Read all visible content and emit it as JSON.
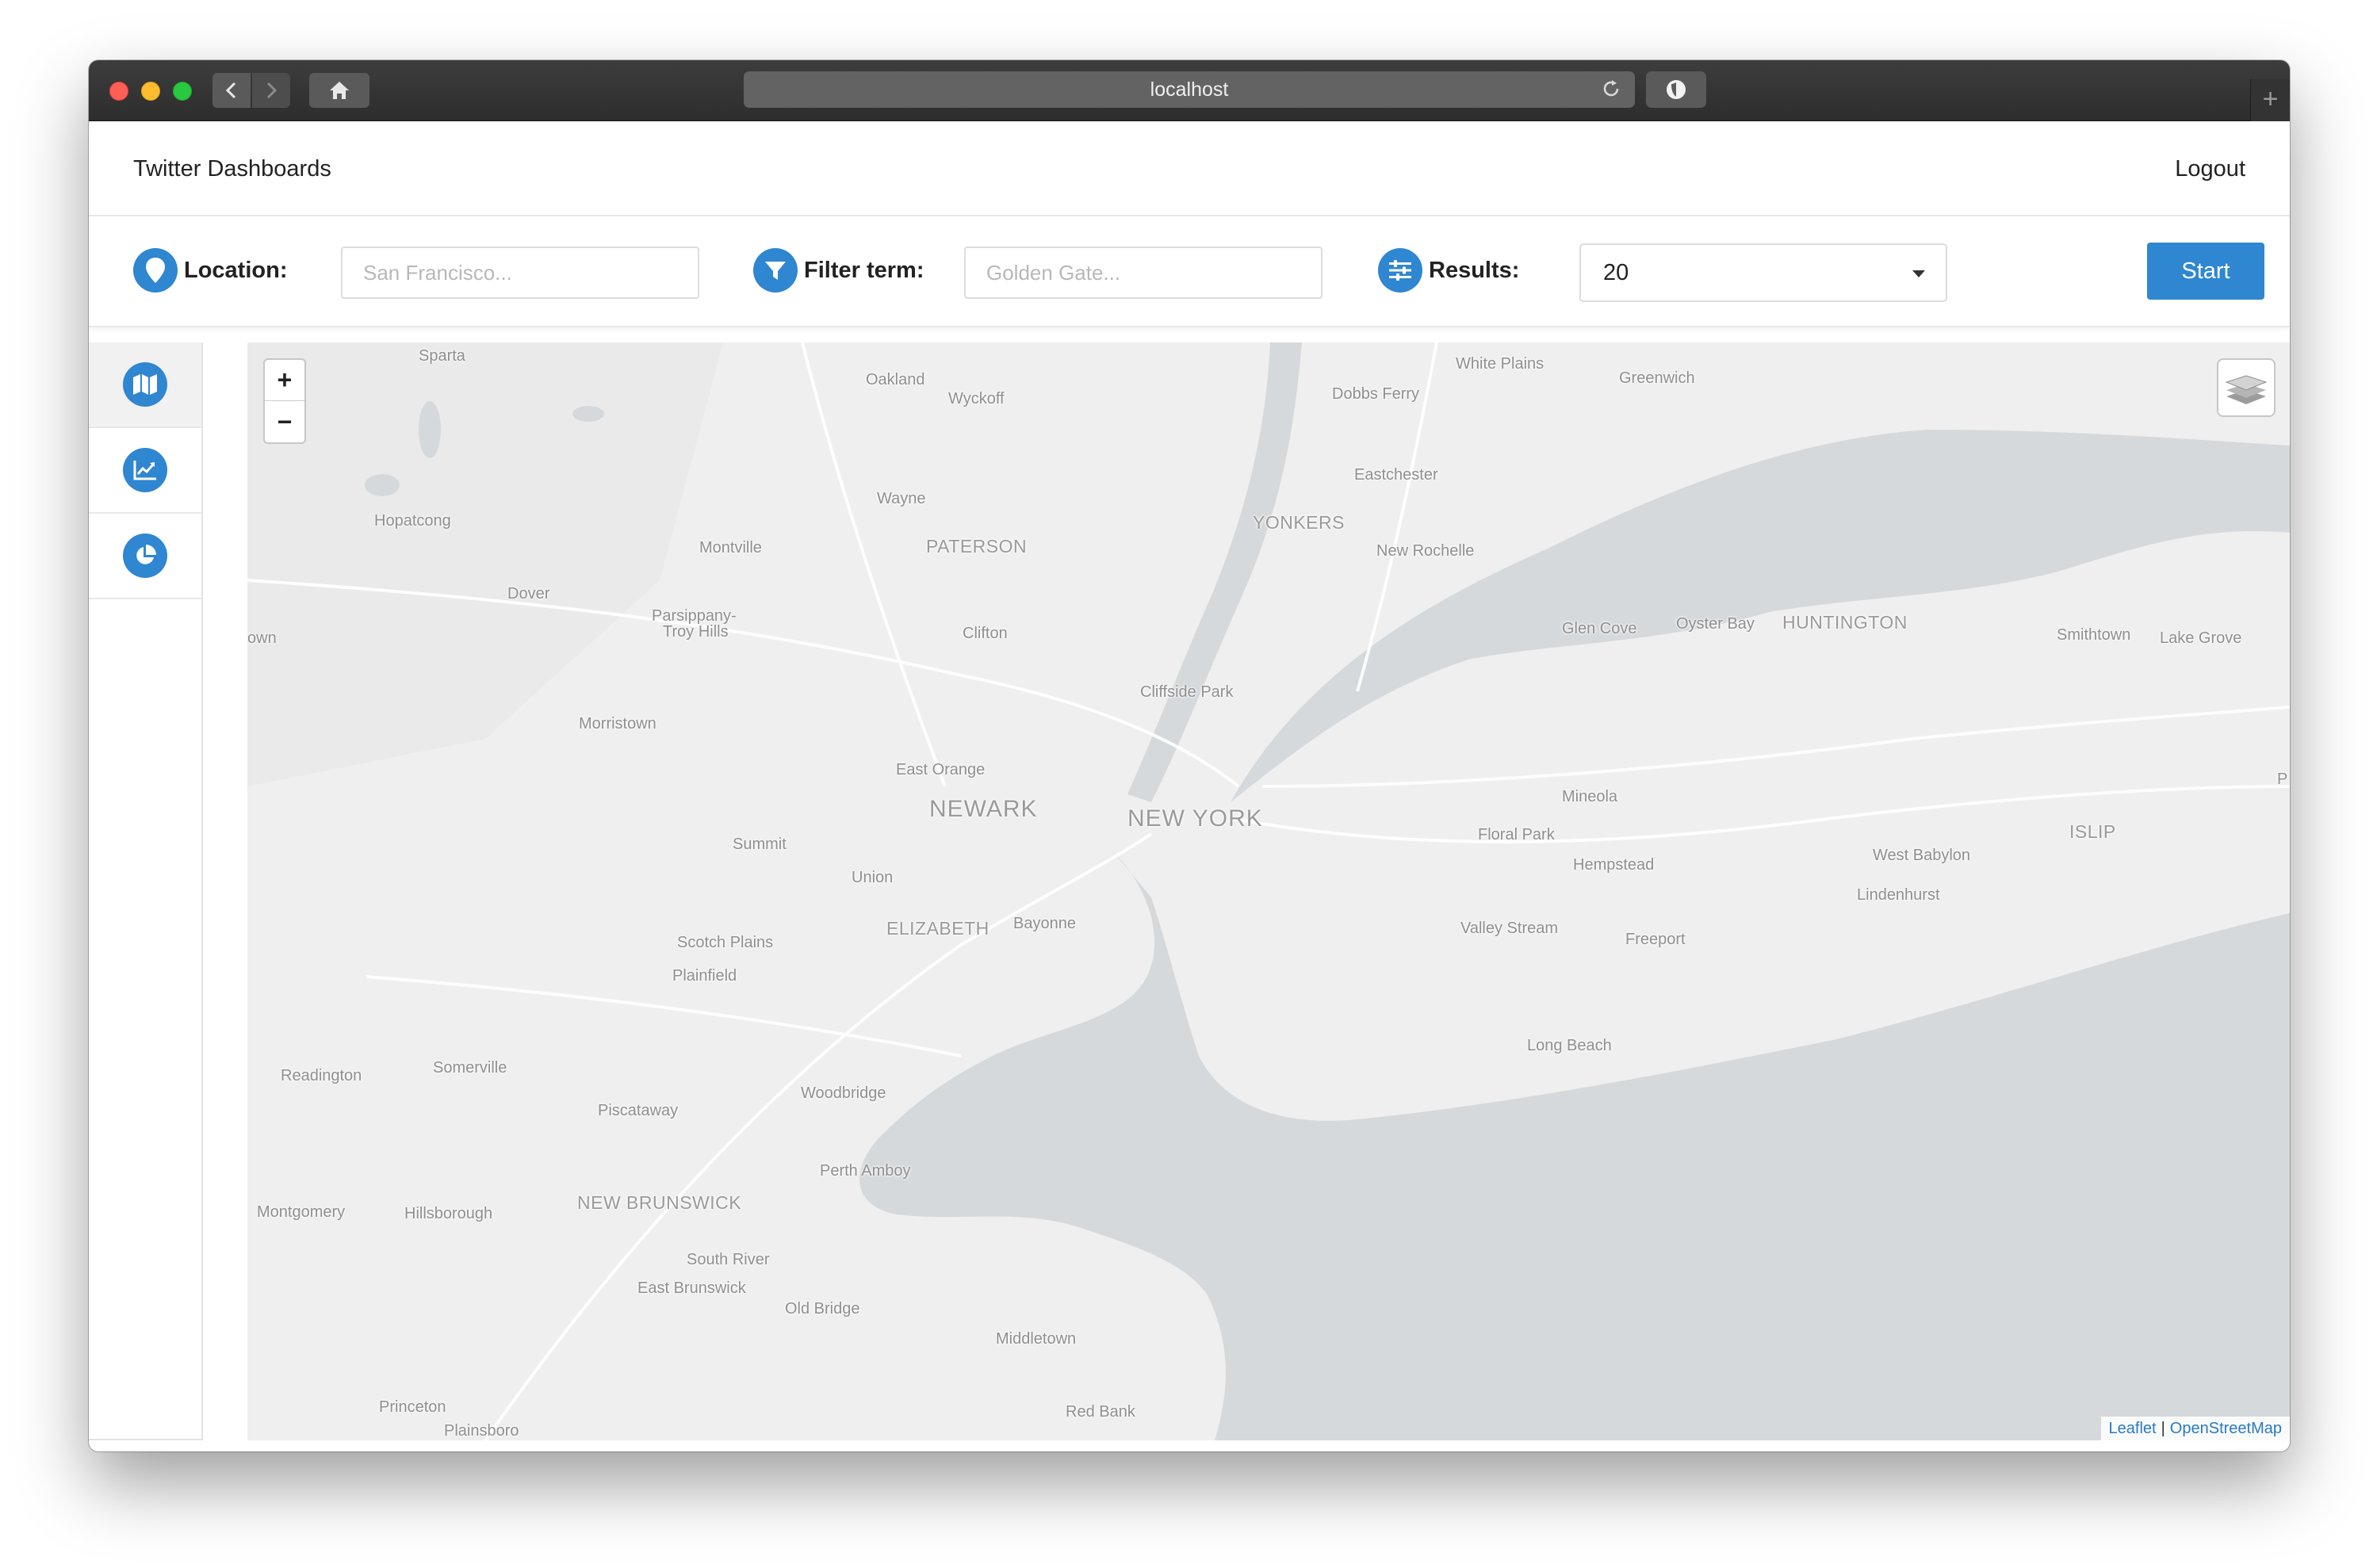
{
  "browser": {
    "url": "localhost"
  },
  "app": {
    "brand": "Twitter Dashboards",
    "logout": "Logout"
  },
  "filters": {
    "location_label": "Location:",
    "location_placeholder": "San Francisco...",
    "filter_label": "Filter term:",
    "filter_placeholder": "Golden Gate...",
    "results_label": "Results:",
    "results_value": "20",
    "start_label": "Start",
    "accent_color": "#2f86d1"
  },
  "sidebar": {
    "items": [
      {
        "icon": "map-icon",
        "active": true
      },
      {
        "icon": "line-chart-icon",
        "active": false
      },
      {
        "icon": "pie-chart-icon",
        "active": false
      }
    ]
  },
  "map": {
    "zoom_in": "+",
    "zoom_out": "−",
    "attribution": {
      "leaflet": "Leaflet",
      "separator": "|",
      "osm": "OpenStreetMap"
    },
    "labels": {
      "sparta": "Sparta",
      "oakland": "Oakland",
      "wyckoff": "Wyckoff",
      "white_plains": "White Plains",
      "greenwich": "Greenwich",
      "dobbs_ferry": "Dobbs Ferry",
      "hopatcong": "Hopatcong",
      "wayne": "Wayne",
      "eastchester": "Eastchester",
      "montville": "Montville",
      "paterson": "PATERSON",
      "yonkers": "YONKERS",
      "new_rochelle": "New Rochelle",
      "dover": "Dover",
      "parsippany": "Parsippany-",
      "troy_hills": "Troy Hills",
      "clifton": "Clifton",
      "glen_cove": "Glen Cove",
      "oyster_bay": "Oyster Bay",
      "huntington": "HUNTINGTON",
      "smithtown": "Smithtown",
      "lake_grove": "Lake Grove",
      "own": "own",
      "cliffside_park": "Cliffside Park",
      "morristown": "Morristown",
      "east_orange": "East Orange",
      "mineola": "Mineola",
      "newark": "NEWARK",
      "new_york": "NEW YORK",
      "floral_park": "Floral Park",
      "islip": "ISLIP",
      "summit": "Summit",
      "hempstead": "Hempstead",
      "west_babylon": "West Babylon",
      "union": "Union",
      "lindenhurst": "Lindenhurst",
      "elizabeth": "ELIZABETH",
      "bayonne": "Bayonne",
      "valley_stream": "Valley Stream",
      "scotch_plains": "Scotch Plains",
      "freeport": "Freeport",
      "plainfield": "Plainfield",
      "long_beach": "Long Beach",
      "readington": "Readington",
      "somerville": "Somerville",
      "woodbridge": "Woodbridge",
      "piscataway": "Piscataway",
      "perth_amboy": "Perth Amboy",
      "new_brunswick": "NEW BRUNSWICK",
      "montgomery": "Montgomery",
      "hillsborough": "Hillsborough",
      "south_river": "South River",
      "east_brunswick": "East Brunswick",
      "old_bridge": "Old Bridge",
      "middletown": "Middletown",
      "princeton": "Princeton",
      "plainsboro": "Plainsboro",
      "red_bank": "Red Bank",
      "p": "P"
    }
  }
}
